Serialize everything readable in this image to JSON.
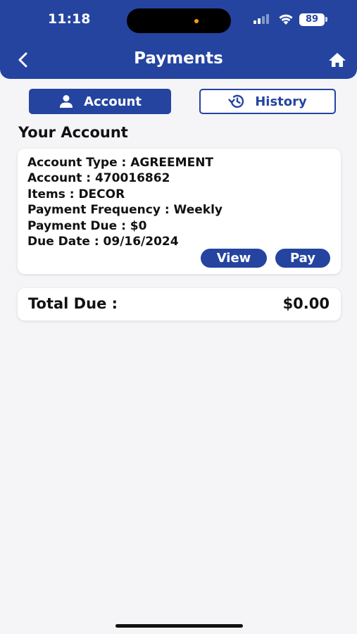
{
  "status_bar": {
    "time": "11:18",
    "battery": "89"
  },
  "header": {
    "title": "Payments",
    "back_icon": "chevron-left-icon",
    "home_icon": "home-icon"
  },
  "tabs": [
    {
      "label": "Account",
      "icon": "person-icon",
      "active": true
    },
    {
      "label": "History",
      "icon": "history-icon",
      "active": false
    }
  ],
  "section_title": "Your Account",
  "account": {
    "lines": [
      "Account Type : AGREEMENT",
      "Account : 470016862",
      "Items : DECOR",
      "Payment Frequency : Weekly",
      "Payment Due : $0",
      "Due Date : 09/16/2024"
    ],
    "view_label": "View",
    "pay_label": "Pay"
  },
  "total": {
    "label": "Total Due :",
    "value": "$0.00"
  },
  "colors": {
    "primary": "#2444a0",
    "background": "#f5f5f7",
    "card": "#ffffff"
  }
}
